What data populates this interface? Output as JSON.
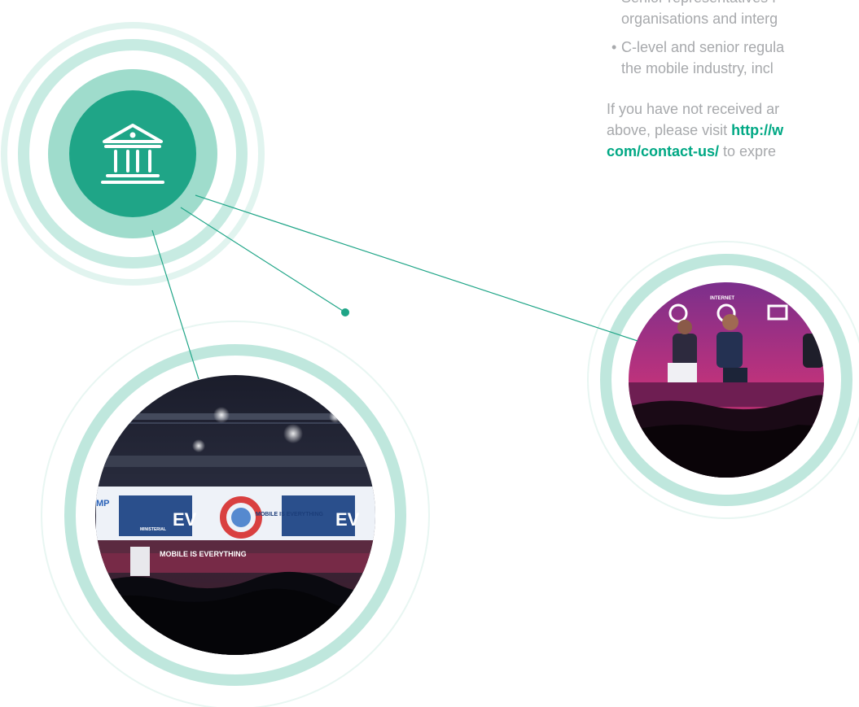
{
  "bullets": [
    {
      "line1": "Senior representatives f",
      "line2": "organisations and interg"
    },
    {
      "line1": "C-level and senior regula",
      "line2": "the mobile industry, incl"
    }
  ],
  "paragraph": {
    "line1": "If you have not received ar",
    "line2_pre": "above, please visit ",
    "line2_link": "http://w",
    "line3_link": "com/contact-us/",
    "line3_post": " to expre"
  },
  "photos": {
    "left": {
      "banner_text": "MOBILE IS EVERYTHING",
      "podium_text": "MINISTERIAL",
      "screen_left": "EV",
      "screen_right": "EV",
      "mp": "MP"
    },
    "right": {
      "screen_label": "INTERNET"
    }
  },
  "icon": "government-building-icon",
  "colors": {
    "accent": "#1fa587",
    "ring_light": "#b9e6da",
    "ring_pale": "#dcf2ec",
    "text": "#a7a9ac",
    "link": "#00a884"
  }
}
